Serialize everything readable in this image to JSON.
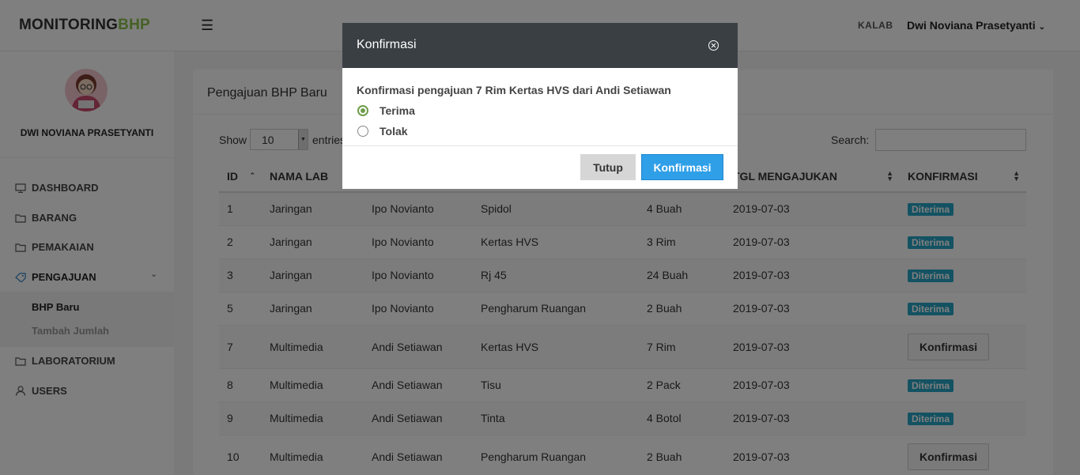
{
  "header": {
    "brand_part1": "MONITORING",
    "brand_part2": "BHP",
    "role": "KALAB",
    "user_name": "Dwi Noviana Prasetyanti"
  },
  "sidebar": {
    "profile_name": "DWI NOVIANA PRASETYANTI",
    "items": [
      {
        "label": "DASHBOARD",
        "icon": "monitor-icon"
      },
      {
        "label": "BARANG",
        "icon": "folder-icon"
      },
      {
        "label": "PEMAKAIAN",
        "icon": "folder-icon"
      },
      {
        "label": "PENGAJUAN",
        "icon": "tag-icon"
      },
      {
        "label": "LABORATORIUM",
        "icon": "folder-icon"
      },
      {
        "label": "USERS",
        "icon": "user-icon"
      }
    ],
    "submenu": [
      "BHP Baru",
      "Tambah Jumlah"
    ]
  },
  "content": {
    "title": "Pengajuan BHP Baru",
    "show_label": "Show",
    "page_size": "10",
    "entries_label": "entries",
    "search_label": "Search:",
    "columns": [
      "ID",
      "NAMA LAB",
      "TGL MENGAJUKAN",
      "KONFIRMASI"
    ],
    "rows": [
      {
        "id": "1",
        "lab": "Jaringan",
        "user": "Ipo Novianto",
        "item": "Spidol",
        "qty": "4 Buah",
        "date": "2019-07-03",
        "status": "Diterima"
      },
      {
        "id": "2",
        "lab": "Jaringan",
        "user": "Ipo Novianto",
        "item": "Kertas HVS",
        "qty": "3 Rim",
        "date": "2019-07-03",
        "status": "Diterima"
      },
      {
        "id": "3",
        "lab": "Jaringan",
        "user": "Ipo Novianto",
        "item": "Rj 45",
        "qty": "24 Buah",
        "date": "2019-07-03",
        "status": "Diterima"
      },
      {
        "id": "5",
        "lab": "Jaringan",
        "user": "Ipo Novianto",
        "item": "Pengharum Ruangan",
        "qty": "2 Buah",
        "date": "2019-07-03",
        "status": "Diterima"
      },
      {
        "id": "7",
        "lab": "Multimedia",
        "user": "Andi Setiawan",
        "item": "Kertas HVS",
        "qty": "7 Rim",
        "date": "2019-07-03",
        "status": "Konfirmasi"
      },
      {
        "id": "8",
        "lab": "Multimedia",
        "user": "Andi Setiawan",
        "item": "Tisu",
        "qty": "2 Pack",
        "date": "2019-07-03",
        "status": "Diterima"
      },
      {
        "id": "9",
        "lab": "Multimedia",
        "user": "Andi Setiawan",
        "item": "Tinta",
        "qty": "4 Botol",
        "date": "2019-07-03",
        "status": "Diterima"
      },
      {
        "id": "10",
        "lab": "Multimedia",
        "user": "Andi Setiawan",
        "item": "Pengharum Ruangan",
        "qty": "2 Buah",
        "date": "2019-07-03",
        "status": "Konfirmasi"
      }
    ]
  },
  "modal": {
    "title": "Konfirmasi",
    "question": "Konfirmasi pengajuan 7 Rim Kertas HVS dari Andi Setiawan",
    "option_accept": "Terima",
    "option_reject": "Tolak",
    "selected": "Terima",
    "close_label": "Tutup",
    "confirm_label": "Konfirmasi"
  },
  "colors": {
    "brand_accent": "#8bc34a",
    "badge": "#26a4c5",
    "primary_button": "#2f9fe8",
    "modal_header": "#3a3f44"
  }
}
